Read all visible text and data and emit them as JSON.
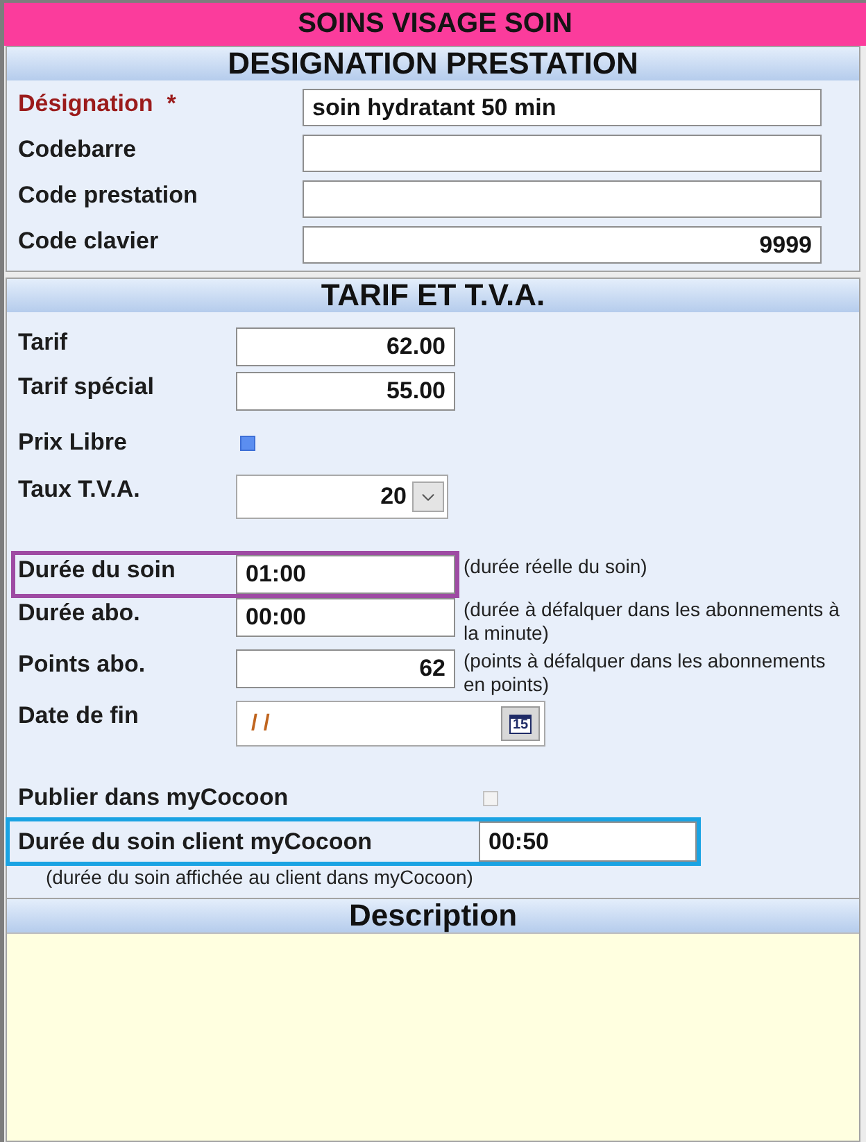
{
  "title": "SOINS VISAGE SOIN",
  "sections": [
    {
      "kind": "designation",
      "heading": "DESIGNATION PRESTATION",
      "groups": [
        {
          "fields": [
            {
              "kind": "text",
              "label": "Désignation",
              "required_mark": "*",
              "value": "soin hydratant 50 min"
            },
            {
              "kind": "text",
              "label": "Codebarre"
            },
            {
              "kind": "text",
              "label": "Code prestation"
            },
            {
              "kind": "number",
              "label": "Code clavier",
              "value": "9999"
            }
          ]
        }
      ]
    },
    {
      "kind": "tarif",
      "heading": "TARIF ET T.V.A.",
      "groups": [
        {
          "fields": [
            {
              "kind": "number",
              "label": "Tarif",
              "value": "62.00"
            },
            {
              "kind": "number",
              "label": "Tarif spécial",
              "value": "55.00"
            },
            {
              "kind": "checkbox",
              "label": "Prix Libre",
              "checked": true
            },
            {
              "kind": "select",
              "label": "Taux T.V.A.",
              "value": "20"
            }
          ]
        },
        {
          "fields": [
            {
              "kind": "time",
              "label": "Durée du soin",
              "value": "01:00",
              "hint": "(durée réelle du soin)",
              "color": "#9e4ba3"
            },
            {
              "kind": "time",
              "label": "Durée abo.",
              "value": "00:00",
              "hint": "(durée à défalquer dans les abonnements à la minute)"
            },
            {
              "kind": "number",
              "label": "Points abo.",
              "value": "62",
              "hint": "(points à défalquer dans les abonnements en points)"
            },
            {
              "kind": "date",
              "label": "Date de fin",
              "value": "/ /",
              "calendar_label": "15"
            }
          ]
        },
        {
          "fields": [
            {
              "kind": "checkbox",
              "label": "Publier dans myCocoon",
              "checked": false
            },
            {
              "kind": "time",
              "label": "Durée du soin client myCocoon",
              "value": "00:50",
              "hint": "(durée du soin affichée au client dans myCocoon)",
              "color": "#1aa3e3"
            }
          ]
        }
      ]
    },
    {
      "kind": "notes",
      "heading": "Description"
    }
  ]
}
